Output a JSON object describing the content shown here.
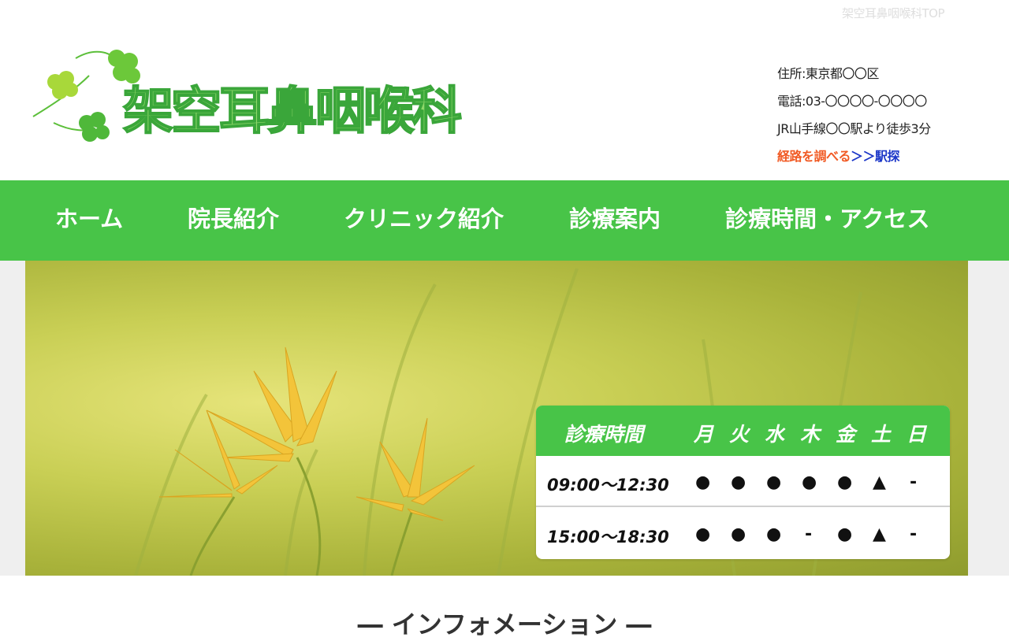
{
  "header": {
    "top_link": "架空耳鼻咽喉科TOP",
    "logo_text": "架空耳鼻咽喉科",
    "address": "住所:東京都〇〇区",
    "phone": "電話:03-〇〇〇〇-〇〇〇〇",
    "access": "JR山手線〇〇駅より徒歩3分",
    "route_link": "経路を調べる",
    "ekitan_link": "＞＞駅探"
  },
  "nav": {
    "items": [
      "ホーム",
      "院長紹介",
      "クリニック紹介",
      "診療案内",
      "診療時間・アクセス"
    ]
  },
  "hours": {
    "title": "診療時間",
    "days": [
      "月",
      "火",
      "水",
      "木",
      "金",
      "土",
      "日"
    ],
    "rows": [
      {
        "time": "09:00〜12:30",
        "marks": [
          "●",
          "●",
          "●",
          "●",
          "●",
          "▲",
          "-"
        ]
      },
      {
        "time": "15:00〜18:30",
        "marks": [
          "●",
          "●",
          "●",
          "-",
          "●",
          "▲",
          "-"
        ]
      }
    ]
  },
  "info": {
    "heading": "― インフォメーション ―"
  },
  "colors": {
    "nav_bg": "#48c448",
    "route_link": "#f15a24",
    "ekitan_link": "#1a35c8"
  },
  "icons": [
    "clover-icon"
  ]
}
